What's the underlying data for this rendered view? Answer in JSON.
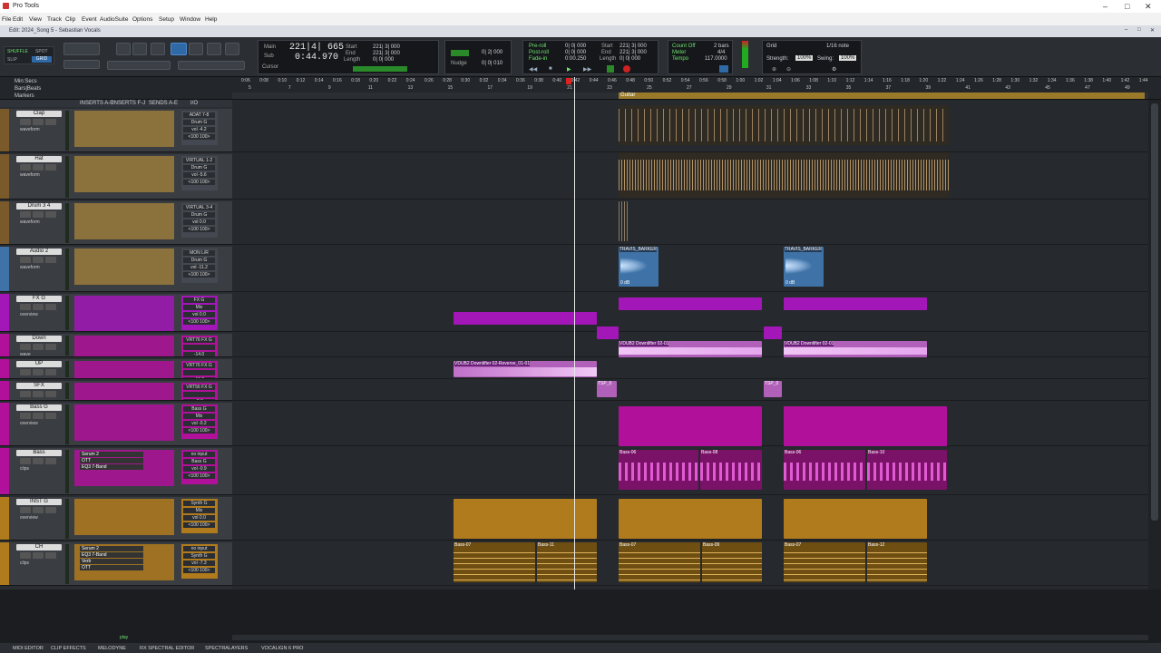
{
  "window": {
    "title": "Pro Tools",
    "document": "Edit: 2024_Song 5 - Sebastian Vocals"
  },
  "menu": [
    "File",
    "Edit",
    "View",
    "Track",
    "Clip",
    "Event",
    "AudioSuite",
    "Options",
    "Setup",
    "Window",
    "Help"
  ],
  "toolbar": {
    "modes": [
      "SHUFFLE",
      "SPOT",
      "SLIP",
      "GRID"
    ],
    "main_counter": "221|4| 665",
    "sub_counter": "0:44.970",
    "main_label": "Main",
    "sub_label": "Sub",
    "cursor_label": "Cursor",
    "start_label": "Start",
    "end_label": "End",
    "length_label": "Length",
    "start_value": "221| 3| 000",
    "end_value": "221| 3| 000",
    "length_value": "0| 0| 000",
    "nudge_label": "Nudge",
    "grid_label": "Grid",
    "nudge_value": "0| 0| 010",
    "grid_value": "0| 2| 000",
    "preroll": "Pre-roll",
    "postroll": "Post-roll",
    "fadein": "Fade-in",
    "pre_value": "0| 0| 000",
    "post_value": "0| 0| 000",
    "fade_value": "0:00.250",
    "count_off": "Count Off",
    "meter": "Meter",
    "tempo": "Tempo",
    "bars": "2 bars",
    "meter_value": "4/4",
    "tempo_value": "117.0000",
    "grid_right": "Grid",
    "grid_right_value": "1/16 note",
    "strength_label": "Strength:",
    "strength_value": "100%",
    "swing_label": "Swing:",
    "swing_value": "100%"
  },
  "rulers": {
    "labels": [
      "Min:Secs",
      "Bars|Beats",
      "Markers"
    ],
    "min_ticks": [
      "0:06",
      "0:08",
      "0:10",
      "0:12",
      "0:14",
      "0:16",
      "0:18",
      "0:20",
      "0:22",
      "0:24",
      "0:26",
      "0:28",
      "0:30",
      "0:32",
      "0:34",
      "0:36",
      "0:38",
      "0:40",
      "0:42",
      "0:44",
      "0:46",
      "0:48",
      "0:50",
      "0:52",
      "0:54",
      "0:56",
      "0:58",
      "1:00",
      "1:02",
      "1:04",
      "1:06",
      "1:08",
      "1:10",
      "1:12",
      "1:14",
      "1:16",
      "1:18",
      "1:20",
      "1:22",
      "1:24",
      "1:26",
      "1:28",
      "1:30",
      "1:32",
      "1:34",
      "1:36",
      "1:38",
      "1:40",
      "1:42",
      "1:44"
    ],
    "bar_ticks": [
      "5",
      "7",
      "9",
      "11",
      "13",
      "15",
      "17",
      "19",
      "21",
      "23",
      "25",
      "27",
      "29",
      "31",
      "33",
      "35",
      "37",
      "39",
      "41",
      "43",
      "45",
      "47",
      "49"
    ],
    "marker": "Guitar"
  },
  "column_headers": [
    "INSERTS A-E",
    "INSERTS F-J",
    "SENDS A-E",
    "I/O"
  ],
  "tracks": [
    {
      "name": "Clap",
      "io_in": "ADAT 7-8",
      "io_out": "Drum G",
      "vol": "vol -4.2",
      "pan": "<100 100>",
      "view": "waveform"
    },
    {
      "name": "Hat",
      "io_in": "VIRTUAL 1-2",
      "io_out": "Drum G",
      "vol": "vol -5.6",
      "pan": "<100 100>",
      "view": "waveform"
    },
    {
      "name": "Drum 3 4",
      "io_in": "VIRTUAL 3-4",
      "io_out": "Drum G",
      "vol": "vol 0.0",
      "pan": "<100 100>",
      "view": "waveform"
    },
    {
      "name": "Audio 2",
      "io_in": "MON L/R",
      "io_out": "Drum G",
      "vol": "vol -11.2",
      "pan": "<100 100>",
      "view": "waveform"
    },
    {
      "name": "FX G",
      "io_in": "FX G",
      "io_out": "Mix",
      "vol": "vol 0.0",
      "pan": "<100 100>",
      "view": "overview"
    },
    {
      "name": "Down",
      "io_in": "VRT76 FX G",
      "io_out": "",
      "vol": "-14.0",
      "pan": "P",
      "view": "wave"
    },
    {
      "name": "UP",
      "io_in": "VRT76 FX G",
      "io_out": "",
      "vol": "-16.2",
      "pan": "P",
      "view": "wave"
    },
    {
      "name": "SFX",
      "io_in": "VRT56 FX G",
      "io_out": "",
      "vol": "-3.3",
      "pan": "P",
      "view": "wave"
    },
    {
      "name": "Bass G",
      "io_in": "Bass G",
      "io_out": "Mix",
      "vol": "vol -0.2",
      "pan": "<100 100>",
      "view": "overview"
    },
    {
      "name": "Bass",
      "io_in": "no input",
      "io_out": "Bass G",
      "vol": "vol -0.9",
      "pan": "<100 100>",
      "view": "clips",
      "inserts": [
        "Serum 2",
        "OTT",
        "EQ3 7-Band"
      ]
    },
    {
      "name": "INST G",
      "io_in": "Synth G",
      "io_out": "Mix",
      "vol": "vol 0.0",
      "pan": "<100 100>",
      "view": "overview"
    },
    {
      "name": "CH",
      "io_in": "no input",
      "io_out": "Synth G",
      "vol": "vol -7.3",
      "pan": "<100 100>",
      "view": "clips",
      "inserts": [
        "Serum 2",
        "EQ3 7-Band",
        "Verb",
        "OTT"
      ]
    }
  ],
  "clips": {
    "travis1": "TRAVIS_BARKER",
    "travis2": "TRAVIS_BARKER",
    "gain": "0 dB",
    "vdub_rev": "VDUB2 Downlifter 02-Reverse_01-01",
    "vdub1": "VDUB2 Downlifter 02-01",
    "vdub2": "VDUB2 Downlifter 02-01",
    "tsp1": "TSP_0",
    "tsp2": "TSP_0",
    "bass1": "Bass-06",
    "bass2": "Bass-08",
    "bass3": "Bass-06",
    "bass4": "Bass-10",
    "ch1": "Bass-07",
    "ch2": "Bass-11",
    "ch3": "Bass-07",
    "ch4": "Bass-09",
    "ch5": "Bass-07",
    "ch6": "Bass-12"
  },
  "bottom_tabs": [
    "MIDI EDITOR",
    "CLIP EFFECTS",
    "MELODYNE",
    "RX SPECTRAL EDITOR",
    "SPECTRALAYERS",
    "VOCALIGN 6 PRO"
  ],
  "status": "play",
  "colors": {
    "purple": "#a316b8",
    "magenta": "#b1119a",
    "gold": "#b07b1c",
    "blue": "#3f73a8",
    "drum": "#7a5a2a"
  }
}
